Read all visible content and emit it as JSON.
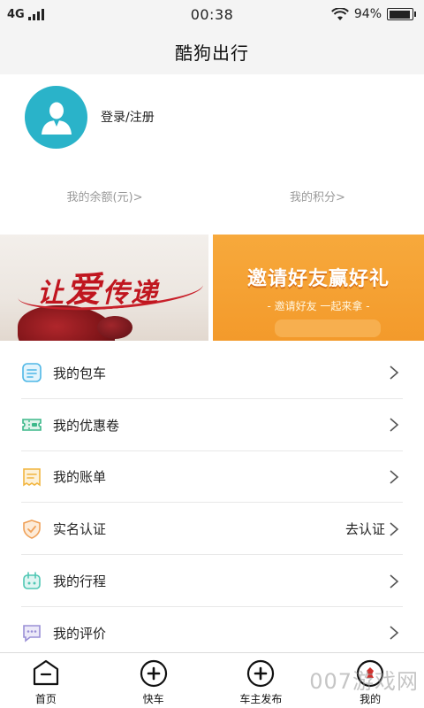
{
  "status_bar": {
    "network": "4G",
    "time": "00:38",
    "battery_percent": "94%",
    "battery_level": 0.94
  },
  "header": {
    "title": "酷狗出行"
  },
  "profile": {
    "login_label": "登录/注册",
    "avatar_icon": "user-avatar-icon"
  },
  "balances": {
    "balance_label": "我的余额(元)>",
    "points_label": "我的积分>"
  },
  "banners": {
    "left_text_1": "让",
    "left_text_2": "爱",
    "left_text_3": "传递",
    "right_title": "邀请好友赢好礼",
    "right_subtitle": "- 邀请好友  一起来拿 -"
  },
  "menu": {
    "items": [
      {
        "label": "我的包车",
        "icon": "charter-car-icon",
        "color": "#4fb7e6",
        "extra": ""
      },
      {
        "label": "我的优惠卷",
        "icon": "coupon-icon",
        "color": "#3db88a",
        "extra": ""
      },
      {
        "label": "我的账单",
        "icon": "bill-icon",
        "color": "#f2b640",
        "extra": ""
      },
      {
        "label": "实名认证",
        "icon": "shield-verify-icon",
        "color": "#f0a25a",
        "extra": "去认证"
      },
      {
        "label": "我的行程",
        "icon": "trip-icon",
        "color": "#4fc7b4",
        "extra": ""
      },
      {
        "label": "我的评价",
        "icon": "review-chat-icon",
        "color": "#9a8fd6",
        "extra": ""
      }
    ]
  },
  "bottom_nav": {
    "items": [
      {
        "label": "首页",
        "icon": "home-icon"
      },
      {
        "label": "快车",
        "icon": "plus-circle-icon"
      },
      {
        "label": "车主发布",
        "icon": "plus-circle-icon"
      },
      {
        "label": "我的",
        "icon": "profile-icon"
      }
    ]
  },
  "watermark": "007游戏网"
}
